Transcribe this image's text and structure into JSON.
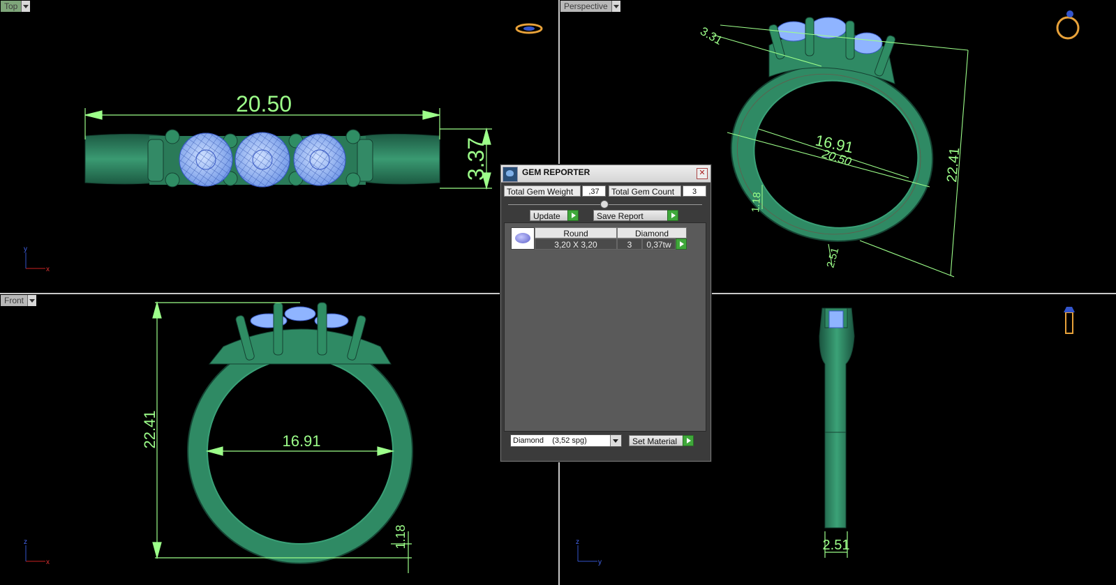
{
  "viewports": {
    "top": {
      "label": "Top",
      "dim_length": "20.50",
      "dim_height": "3.37",
      "axis_v": "y",
      "axis_h": "x"
    },
    "perspective": {
      "label": "Perspective",
      "dim_a": "3.31",
      "dim_inner": "16.91",
      "dim_outer": "20.50",
      "dim_height": "22.41",
      "dim_side": "1.18",
      "dim_bottom": "2.51"
    },
    "front": {
      "label": "Front",
      "dim_height": "22.41",
      "dim_inner": "16.91",
      "dim_shank": "1.18",
      "axis_v": "z",
      "axis_h": "x"
    },
    "right": {
      "dim_width": "2.51",
      "axis_v": "z",
      "axis_h": "y"
    }
  },
  "gem_reporter": {
    "title": "GEM REPORTER",
    "close_glyph": "✕",
    "total_weight_label": "Total Gem Weight",
    "total_weight_value": ",37",
    "total_count_label": "Total Gem Count",
    "total_count_value": "3",
    "update_label": "Update",
    "save_report_label": "Save Report",
    "gems": [
      {
        "cut": "Round",
        "material": "Diamond",
        "size": "3,20 X 3,20",
        "count": "3",
        "weight": "0,37tw"
      }
    ],
    "material_select": "Diamond    (3,52 spg)",
    "set_material_label": "Set Material"
  },
  "colors": {
    "model": "#2f7d5e",
    "gem": "#8fb4ff",
    "dimension": "#9dff8a",
    "background": "#000000"
  }
}
